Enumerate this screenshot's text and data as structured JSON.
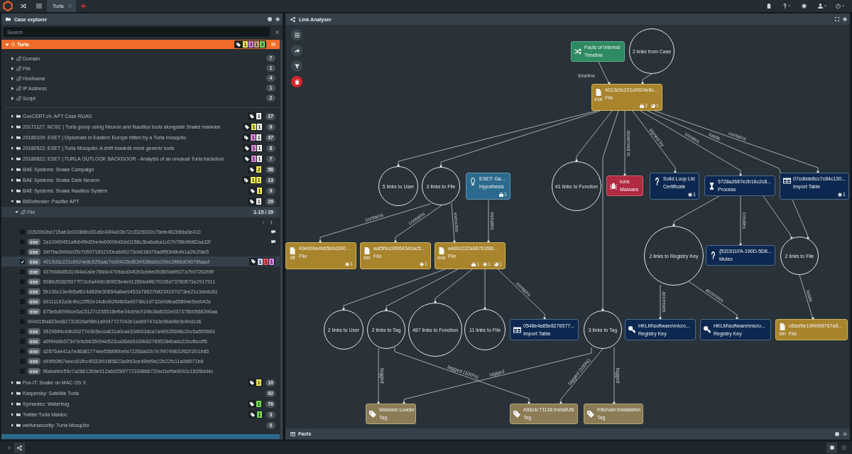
{
  "top_bar": {
    "tabs": [
      {
        "label": "Turla",
        "selected": true
      }
    ]
  },
  "case_explorer": {
    "title": "Case explorer",
    "search": {
      "placeholder": "Search"
    },
    "case": {
      "name": "Turla",
      "expanded": true,
      "tags": [
        {
          "count": "1",
          "color": "#eeee55"
        },
        {
          "count": "3",
          "color": "#dd88dd"
        },
        {
          "count": "1",
          "color": "#e0a070"
        },
        {
          "count": "3",
          "color": "#77dd55"
        }
      ],
      "groups": [
        {
          "name": "Domain",
          "expanded": false,
          "count": "7"
        },
        {
          "name": "File",
          "expanded": false,
          "count": "1"
        },
        {
          "name": "Hostname",
          "expanded": false,
          "count": "4"
        },
        {
          "name": "IP Address",
          "expanded": false,
          "count": "1"
        },
        {
          "name": "Script",
          "expanded": false,
          "count": "2"
        }
      ]
    },
    "sources": [
      {
        "name": "GovCERT.ch: APT Case RUAG",
        "expanded": false,
        "tags": [
          {
            "count": "1",
            "color": "#f2f2f2"
          }
        ],
        "count": "27"
      },
      {
        "name": "20171127: NCSC | Turla group using Neuron and Nautilus tools alongside Snake malware",
        "expanded": false,
        "tags": [
          {
            "count": "1",
            "color": "#eeee55"
          },
          {
            "count": "1",
            "color": "#f2f2f2"
          }
        ],
        "count": "9"
      },
      {
        "name": "20180109: ESET | Diplomats in Eastern Europe bitten by a Turla mosquito",
        "expanded": false,
        "tags": [
          {
            "count": "1",
            "color": "#dd88dd"
          },
          {
            "count": "1",
            "color": "#f2f2f2"
          }
        ],
        "count": "37"
      },
      {
        "name": "20180522: ESET | Turla Mosquito: A shift towards more generic tools",
        "expanded": false,
        "tags": [
          {
            "count": "1",
            "color": "#dd88dd"
          },
          {
            "count": "1",
            "color": "#f2f2f2"
          }
        ],
        "count": "8"
      },
      {
        "name": "20180822: ESET | TURLA OUTLOOK BACKDOOR - Analysis of an unusual Turla backdoor",
        "expanded": false,
        "tags": [
          {
            "count": "1",
            "color": "#dd88dd"
          },
          {
            "count": "1",
            "color": "#f2f2f2"
          }
        ],
        "count": "7"
      },
      {
        "name": "BAE Systems: Snake Campaign",
        "expanded": false,
        "tags": [
          {
            "count": "2",
            "color": "#eeee55"
          }
        ],
        "count": "58"
      },
      {
        "name": "BAE Systems: Snake Dark Neuron",
        "expanded": false,
        "tags": [
          {
            "count": "1",
            "color": "#eeee55"
          },
          {
            "count": "1",
            "color": "#eeee55"
          }
        ],
        "count": "13"
      },
      {
        "name": "BAE Systems: Snake Nautilus System",
        "expanded": false,
        "tags": [
          {
            "count": "1",
            "color": "#eeee55"
          }
        ],
        "count": "9"
      },
      {
        "name": "BitDefender: Pacifier APT",
        "expanded": true,
        "tags": [
          {
            "count": "1",
            "color": "#f2f2f2"
          }
        ],
        "count": "29",
        "groups": [
          {
            "name": "File",
            "expanded": true,
            "range": "1-15 / 29",
            "items": [
              {
                "hash": "01520b3be715ab3c01086bd31a5c43f4a03b72c3326002c79efe462b66a0e410",
                "checked": false,
                "commented": true
              },
              {
                "ext": "exe",
                "hash": "2a10969451afb64f9d2be4e6900bd2dd1158c3ba6afca1c07b7f8b9fd82aa33f",
                "checked": false,
                "commented": true
              },
              {
                "ext": "exe",
                "hash": "34f7fac549dcf2fc7b59718021f0ea6d9273cb618d79adff50b6b4b1a2fc2fab5",
                "checked": false,
                "commented": false
              },
              {
                "ext": "exe",
                "hash": "4013d3c221c6924e8c525aac7ed0402bd534928dcbc20bc1ff6bd09079faacf",
                "checked": true,
                "commented": false,
                "tags": [
                  {
                    "count": "1",
                    "color": "#c4d4f4"
                  },
                  {
                    "count": "1",
                    "color": "#e05a5a"
                  },
                  {
                    "count": "1",
                    "color": "#d58ce8"
                  }
                ]
              },
              {
                "ext": "exe",
                "hash": "437b6848531064a1a0e766dc4709dcd34f2b3cbbe0936f0abf927a7b07262b5f",
                "checked": false,
                "commented": false
              },
              {
                "ext": "exe",
                "hash": "5086d53825977f72c0a449b369f25e4e9135bbd4f6702d5d73780573e2917511",
                "checked": false,
                "commented": false
              },
              {
                "ext": "exe",
                "hash": "5b136c13e4b5af614d830e30654a8ae9452a76627b8234197d73ee21c3de6c61",
                "checked": false,
                "commented": false
              },
              {
                "ext": "exe",
                "hash": "69111192a3e4fcc1ff52e14dbd92fd4b5a40748c1d732e0dfea65894e5ed042e",
                "checked": false,
                "commented": false
              },
              {
                "ext": "exe",
                "hash": "875e6d099bce5a15127c235518efbe34cb9c9198c8a8152e037378b0568396aa",
                "checked": false,
                "commented": false
              },
              {
                "hash": "904d15fa833ed82732816af98b1a9947727042e1add9747a3c96a98e9c4bd1d6",
                "checked": false,
                "commented": false
              },
              {
                "ext": "exe",
                "hash": "95296ff4c44b30277e3b5ecca611a0cae334b03dca7a49925698c2bc5a559583",
                "checked": false,
                "commented": false
              },
              {
                "ext": "exe",
                "hash": "a0f94e8b57347e9cb635094e523ca36dd9339b627655284babc22bcfbccff5",
                "checked": false,
                "commented": false
              },
              {
                "ext": "exe",
                "hash": "d2876a441a7ed6d81774ee5566f0befa72266a02b7e7f4749832f62f1f01b66",
                "checked": false,
                "commented": false
              },
              {
                "ext": "exe",
                "hash": "d99f50f67aeec81fbc4f333f41f85823a9fd3ce49fef9e22b22fc11a06f071b8",
                "checked": false,
                "commented": false
              },
              {
                "ext": "exe",
                "hash": "f8ababbc59c7a28612b9e912a69250f772339866720ed1ef9a9092c183f6dd4c",
                "checked": false,
                "commented": false
              }
            ]
          }
        ]
      },
      {
        "name": "Fox-IT: Snake on MAC OS X",
        "expanded": false,
        "tags": [
          {
            "count": "1",
            "color": "#eeee55"
          }
        ],
        "count": "10"
      },
      {
        "name": "Kaspersky: Satellite Turla",
        "expanded": false,
        "count": "92"
      },
      {
        "name": "Symantec: Waterbug",
        "expanded": false,
        "tags": [
          {
            "count": "1",
            "color": "#77dd55"
          }
        ],
        "count": "76"
      },
      {
        "name": "Twitter:Turla Maldoc",
        "expanded": false,
        "tags": [
          {
            "count": "1",
            "color": "#77dd55"
          }
        ],
        "count": "3"
      },
      {
        "name": "welivesecurity: Turla Mosquito",
        "expanded": false,
        "count": "0"
      }
    ]
  },
  "link_analyser": {
    "title": "Link Analyser",
    "nodes": [
      {
        "kind": "timeline",
        "title": "Facts of Interest",
        "type": "Timeline"
      },
      {
        "kind": "cluster",
        "label": "2 links from Case"
      },
      {
        "kind": "file",
        "title": "4013d3c221c6924e8c...",
        "type": "File",
        "ext": "exe",
        "counters": [
          {
            "kind": "case",
            "value": "2"
          },
          {
            "kind": "globe",
            "value": "1"
          }
        ]
      },
      {
        "kind": "cluster",
        "label": "5 links to User"
      },
      {
        "kind": "cluster",
        "label": "3 links to File"
      },
      {
        "kind": "hypothesis",
        "title": "ESET: Ga...",
        "type": "Hypothesis",
        "counters": [
          {
            "kind": "case",
            "value": "1"
          }
        ]
      },
      {
        "kind": "cluster",
        "label": "41 links to Function"
      },
      {
        "kind": "malware",
        "title": "turla",
        "type": "Malware"
      },
      {
        "kind": "certificate",
        "title": "Solid Loop Ltd",
        "type": "Certificate",
        "counters": [
          {
            "kind": "gear",
            "value": "1"
          }
        ]
      },
      {
        "kind": "process",
        "title": "5728a2687e2b16c2c8...",
        "type": "Process"
      },
      {
        "kind": "import_table",
        "title": "07cdbde8cc7c84c130...",
        "type": "Import Table",
        "counters": [
          {
            "kind": "gear",
            "value": "1"
          }
        ]
      },
      {
        "kind": "file",
        "title": "49e60be4b65b0d300...",
        "type": "File",
        "ext": "dll",
        "counters": [
          {
            "kind": "gear",
            "value": "1"
          }
        ]
      },
      {
        "kind": "file",
        "title": "aaf5f9cc00f64343ac5...",
        "type": "File",
        "ext": "bin",
        "counters": [
          {
            "kind": "gear",
            "value": "1"
          }
        ]
      },
      {
        "kind": "file",
        "title": "a4d0c222a68761f88...",
        "type": "File",
        "ext": "exe",
        "counters": [
          {
            "kind": "case",
            "value": "1"
          },
          {
            "kind": "gear",
            "value": "1"
          },
          {
            "kind": "globe",
            "value": "1"
          }
        ]
      },
      {
        "kind": "cluster",
        "label": "2 links to Registry Key"
      },
      {
        "kind": "mutex",
        "title": "{531511FA-190D-5D8...",
        "type": "Mutex"
      },
      {
        "kind": "cluster",
        "label": "2 links to File"
      },
      {
        "kind": "cluster",
        "label": "2 links to User"
      },
      {
        "kind": "cluster",
        "label": "2 links to Tag"
      },
      {
        "kind": "cluster",
        "label": "487 links to Function"
      },
      {
        "kind": "cluster",
        "label": "11 links to File"
      },
      {
        "kind": "import_table",
        "title": "0548e4a85e8276577...",
        "type": "Import Table"
      },
      {
        "kind": "cluster",
        "label": "3 links to Tag"
      },
      {
        "kind": "registry_key",
        "title": "HKLM\\software\\micro...",
        "type": "Registry Key"
      },
      {
        "kind": "registry_key",
        "title": "HKLM\\software\\micro...",
        "type": "Registry Key"
      },
      {
        "kind": "file",
        "title": "c6bcf9e10f4998767a8...",
        "type": "File",
        "ext": "bin"
      },
      {
        "kind": "tag",
        "title": "Malware:Loader",
        "type": "Tag"
      },
      {
        "kind": "tag",
        "title": "Att&ck:T1118:InstallUtil",
        "type": "Tag"
      },
      {
        "kind": "tag",
        "title": "Killchain:Installation",
        "type": "Tag"
      }
    ],
    "edge_labels": [
      "timeline",
      "observed in",
      "signed by",
      "creates",
      "loads",
      "contains",
      "contains",
      "contains",
      "executes",
      "includes",
      "contains",
      "creates",
      "accesses",
      "accesses",
      "loads",
      "tagged",
      "tagged (100%)",
      "tagged",
      "tagged (100%)",
      "tagged"
    ]
  },
  "facts": {
    "title": "Facts"
  }
}
